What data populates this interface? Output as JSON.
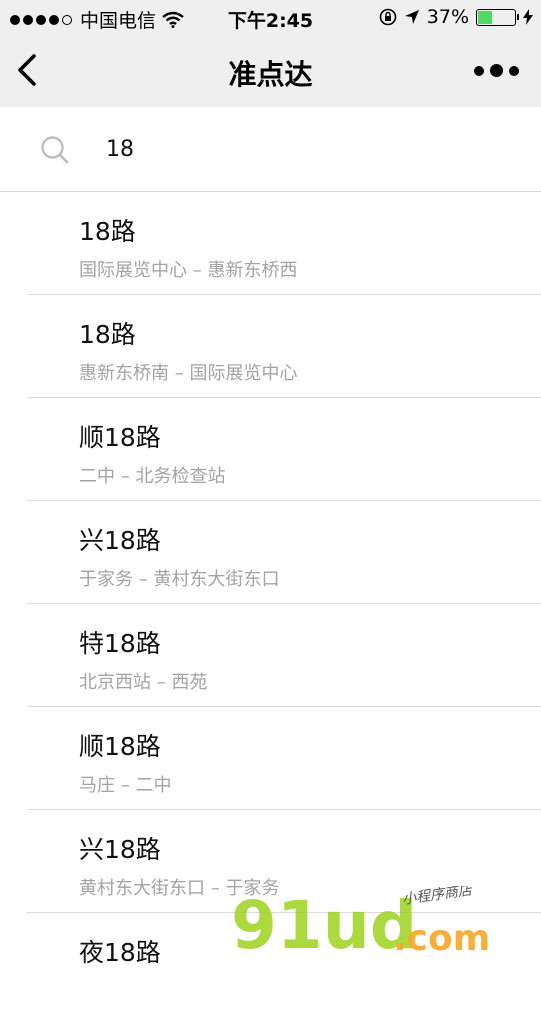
{
  "status_bar": {
    "carrier": "中国电信",
    "time": "下午2:45",
    "battery_percent": "37%",
    "battery_level": 0.37
  },
  "nav": {
    "title": "准点达"
  },
  "search": {
    "value": "18"
  },
  "results": [
    {
      "name": "18路",
      "route": "国际展览中心 – 惠新东桥西"
    },
    {
      "name": "18路",
      "route": "惠新东桥南 – 国际展览中心"
    },
    {
      "name": "顺18路",
      "route": "二中 – 北务检查站"
    },
    {
      "name": "兴18路",
      "route": "于家务 – 黄村东大街东口"
    },
    {
      "name": "特18路",
      "route": "北京西站 – 西苑"
    },
    {
      "name": "顺18路",
      "route": "马庄 – 二中"
    },
    {
      "name": "兴18路",
      "route": "黄村东大街东口 – 于家务"
    },
    {
      "name": "夜18路",
      "route": ""
    }
  ],
  "watermark": {
    "brand": "91ud",
    "domain": ".com",
    "tagline": "小程序商店"
  },
  "colors": {
    "bar_bg": "#efefef",
    "battery_fill": "#4cd964",
    "secondary_text": "#a3a3a3",
    "watermark_green": "#9ed11f",
    "watermark_orange": "#f5a623"
  }
}
